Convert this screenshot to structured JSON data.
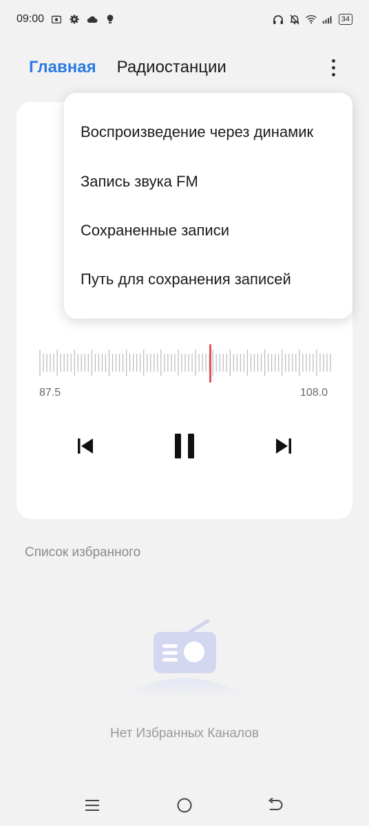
{
  "status_bar": {
    "time": "09:00",
    "battery": "34",
    "left_icons": [
      "screenshot-icon",
      "gear-icon",
      "cloud-icon",
      "bulb-icon"
    ],
    "right_icons": [
      "headphones-icon",
      "bell-off-icon",
      "wifi-icon",
      "signal-icon",
      "battery-icon"
    ]
  },
  "header": {
    "tab_home": "Главная",
    "tab_stations": "Радиостанции",
    "more_icon": "more-vertical-icon"
  },
  "tuner": {
    "min_label": "87.5",
    "max_label": "108.0",
    "needle_color": "#e5505c",
    "tick_color": "#b8b8b8"
  },
  "controls": {
    "prev_icon": "skip-previous-icon",
    "pause_icon": "pause-icon",
    "next_icon": "skip-next-icon"
  },
  "menu": {
    "items": [
      "Воспроизведение через динамик",
      "Запись звука FM",
      "Сохраненные записи",
      "Путь для сохранения записей"
    ]
  },
  "favorites": {
    "title": "Список избранного",
    "empty_text": "Нет Избранных Каналов",
    "empty_icon": "radio-icon"
  },
  "nav_bar": {
    "icons": [
      "menu-icon",
      "home-icon",
      "back-icon"
    ]
  },
  "colors": {
    "accent": "#2a7ae2",
    "background": "#f2f2f2"
  }
}
